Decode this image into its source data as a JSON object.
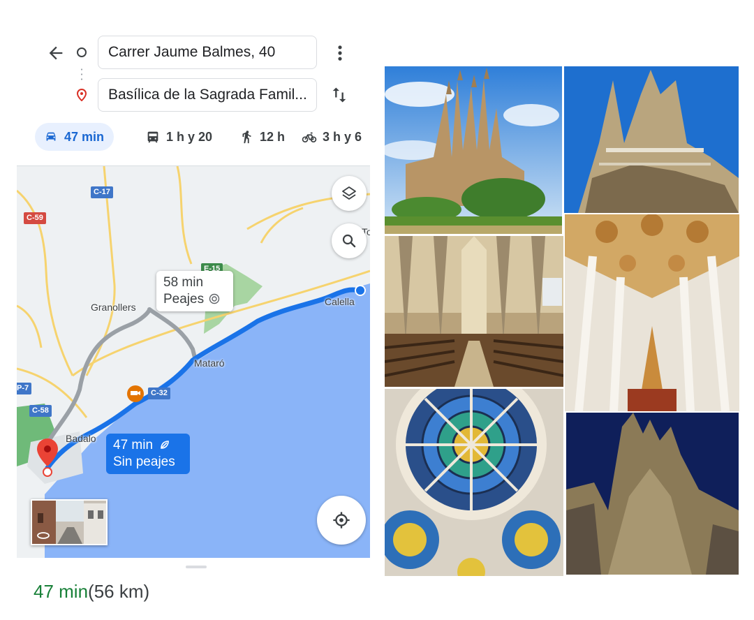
{
  "directions": {
    "origin": "Carrer Jaume Balmes, 40",
    "destination": "Basílica de la Sagrada Famil..."
  },
  "modes": [
    {
      "icon": "car-icon",
      "label": "47 min",
      "active": true
    },
    {
      "icon": "transit-icon",
      "label": "1 h y 20",
      "active": false
    },
    {
      "icon": "walk-icon",
      "label": "12 h",
      "active": false
    },
    {
      "icon": "bike-icon",
      "label": "3 h y 6",
      "active": false
    }
  ],
  "map": {
    "roads": [
      "C-17",
      "C-59",
      "E-15",
      "C-32",
      "C-58",
      "P-7"
    ],
    "places": [
      "Granollers",
      "Mataró",
      "Calella",
      "Badalo",
      "To"
    ],
    "alt_route": {
      "time": "58 min",
      "note": "Peajes"
    },
    "main_route": {
      "time": "47 min",
      "note": "Sin peajes"
    }
  },
  "summary": {
    "time": "47 min",
    "distance": "(56 km)"
  },
  "colors": {
    "route": "#1a73e8",
    "alt_route": "#9e9e9e",
    "active_mode": "#1967d2",
    "summary_time": "#188038",
    "sea": "#8ab4f8"
  },
  "collage": [
    "sagrada-familia-facade-photo",
    "sagrada-familia-towers-photo",
    "nave-interior-photo",
    "vaulted-ceiling-photo",
    "rose-window-photo",
    "night-facade-photo"
  ]
}
